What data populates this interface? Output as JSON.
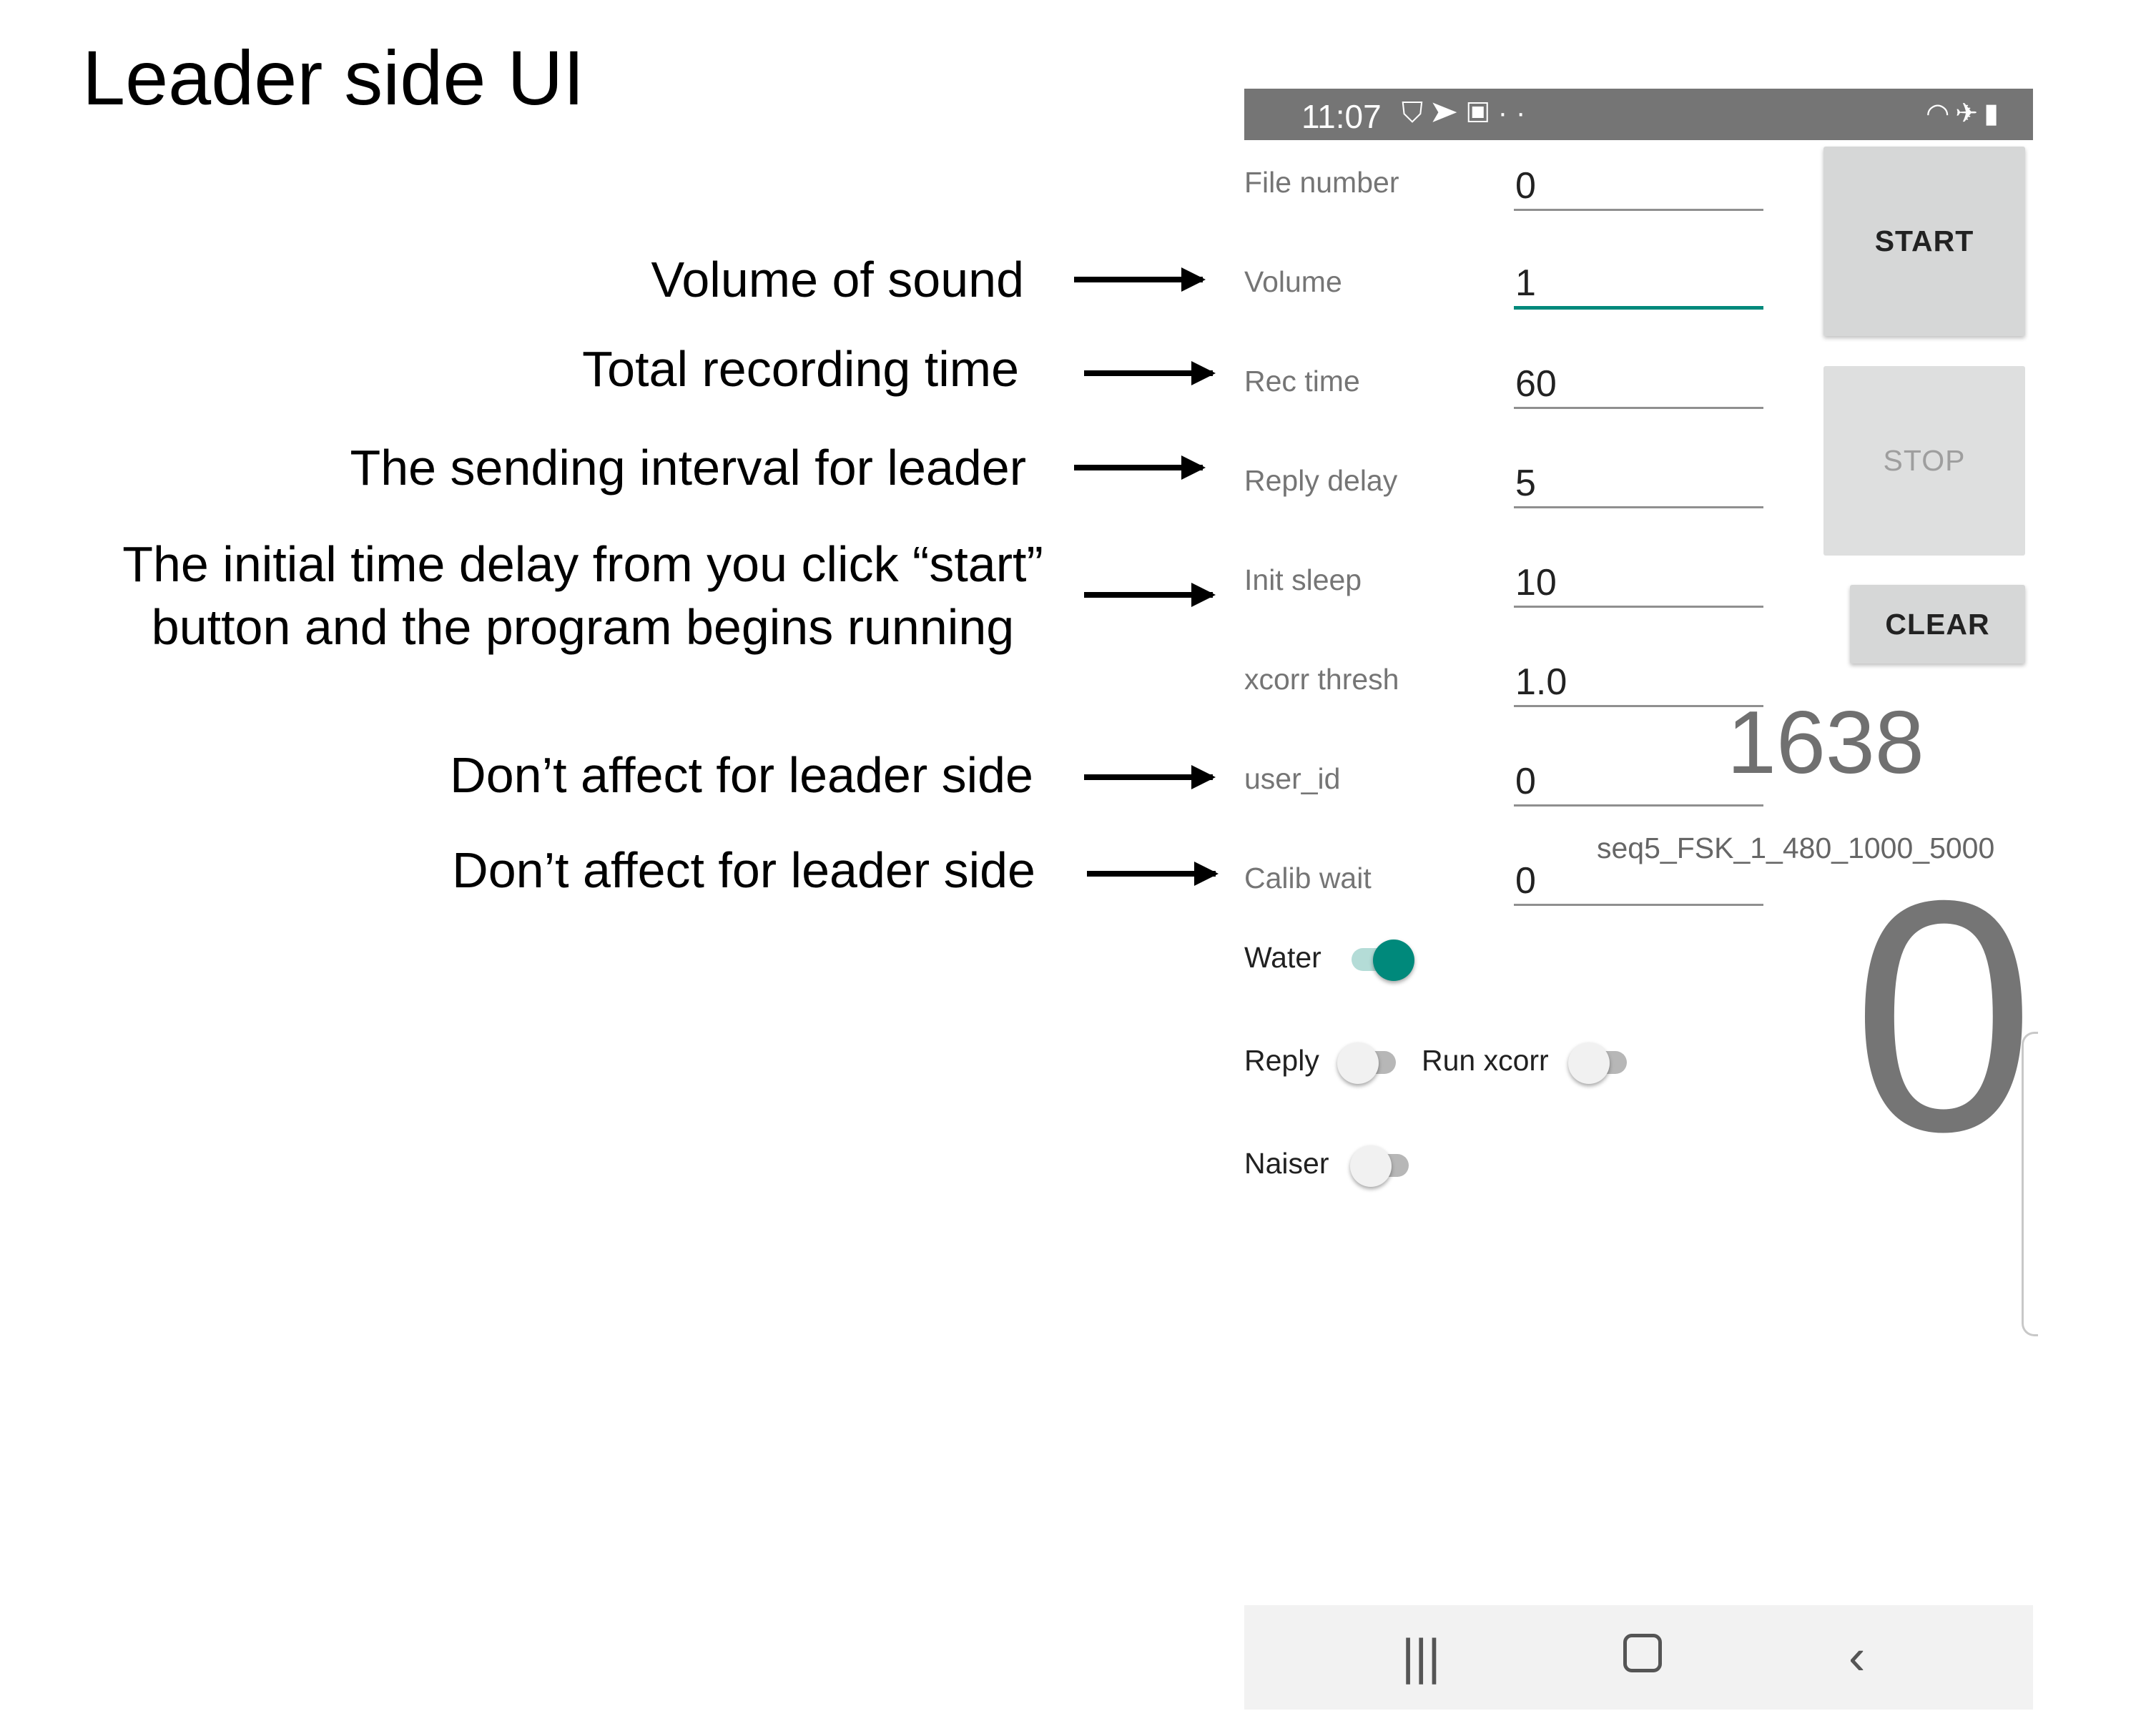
{
  "slide": {
    "title": "Leader side UI",
    "annotations": {
      "volume": "Volume of sound",
      "rec_time": "Total recording time",
      "reply_delay": "The sending interval for leader",
      "init_sleep_line1": "The initial time delay from you click “start”",
      "init_sleep_line2": "button and the program begins running",
      "user_id": "Don’t affect for leader side",
      "calib_wait": "Don’t affect for leader side"
    }
  },
  "status_bar": {
    "time": "11:07",
    "left_icons": [
      "shield-icon",
      "send-icon",
      "image-icon",
      "more-dots-icon"
    ],
    "right_icons": [
      "wifi-icon",
      "airplane-icon",
      "battery-charging-icon"
    ]
  },
  "fields": {
    "file_number": {
      "label": "File number",
      "value": "0"
    },
    "volume": {
      "label": "Volume",
      "value": "1"
    },
    "rec_time": {
      "label": "Rec time",
      "value": "60"
    },
    "reply_delay": {
      "label": "Reply delay",
      "value": "5"
    },
    "init_sleep": {
      "label": "Init sleep",
      "value": "10"
    },
    "xcorr_thresh": {
      "label": "xcorr thresh",
      "value": "1.0"
    },
    "user_id": {
      "label": "user_id",
      "value": "0"
    },
    "calib_wait": {
      "label": "Calib wait",
      "value": "0"
    }
  },
  "buttons": {
    "start": "START",
    "stop": "STOP",
    "clear": "CLEAR"
  },
  "display": {
    "counter": "1638",
    "sequence": "seq5_FSK_1_480_1000_5000",
    "big_value": "0"
  },
  "switches": {
    "water": {
      "label": "Water",
      "on": true
    },
    "reply": {
      "label": "Reply",
      "on": false
    },
    "run_xcorr": {
      "label": "Run xcorr",
      "on": false
    },
    "naiser": {
      "label": "Naiser",
      "on": false
    }
  },
  "colors": {
    "accent": "#00897b",
    "status_bar": "#757575",
    "button": "#d6d7d7"
  }
}
